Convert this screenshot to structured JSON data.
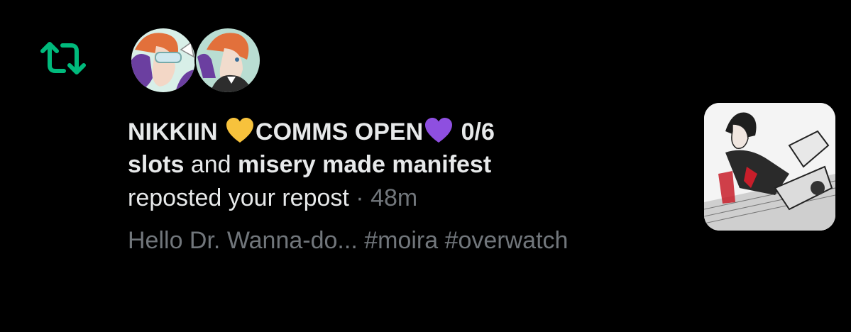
{
  "notification": {
    "type_icon": "repost-icon",
    "accent_color": "#00ba7c",
    "avatars": [
      {
        "name": "avatar-user-1",
        "palette": [
          "#d7efe6",
          "#e2703b",
          "#6b3fa0"
        ]
      },
      {
        "name": "avatar-user-2",
        "palette": [
          "#b9ddd2",
          "#e2703b",
          "#2d2d2d"
        ]
      }
    ],
    "user1_name": "NIKKIIN",
    "emoji_1": "yellow-heart-emoji",
    "user1_name_middle": "COMMS OPEN",
    "emoji_2": "purple-heart-emoji",
    "user1_name_end": "0/6",
    "user1_name_line2": "slots",
    "conjunction": "and",
    "user2_name": "misery made manifest",
    "action_text": "reposted your repost",
    "separator": "·",
    "timestamp": "48m",
    "preview_text": "Hello Dr. Wanna-do... #moira #overwatch",
    "thumbnail": "post-thumbnail-illustration"
  }
}
